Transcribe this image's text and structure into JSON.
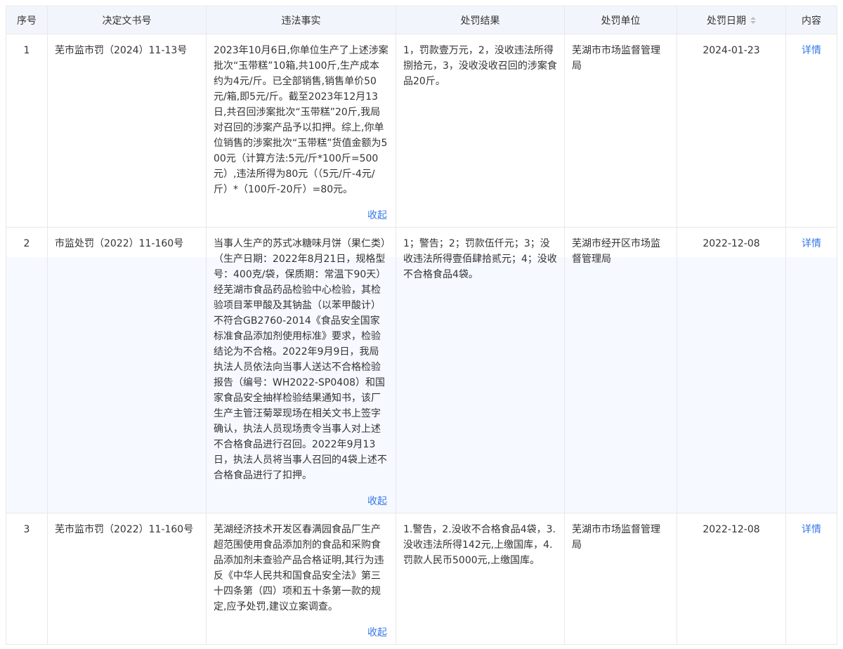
{
  "header": {
    "index": "序号",
    "doc_no": "决定文书号",
    "facts": "违法事实",
    "result": "处罚结果",
    "unit": "处罚单位",
    "date": "处罚日期",
    "content": "内容"
  },
  "rows": [
    {
      "index": "1",
      "doc_no": "芜市监市罚（2024）11-13号",
      "facts": "2023年10月6日,你单位生产了上述涉案批次“玉带糕”10箱,共100斤,生产成本约为4元/斤。已全部销售,销售单价50元/箱,即5元/斤。截至2023年12月13日,共召回涉案批次“玉带糕”20斤,我局对召回的涉案产品予以扣押。综上,你单位销售的涉案批次“玉带糕”货值金额为500元（计算方法:5元/斤*100斤=500元）,违法所得为80元（（5元/斤-4元/斤）*（100斤-20斤）=80元。",
      "result": "1，罚款壹万元，2，没收违法所得捌拾元，3，没收没收召回的涉案食品20斤。",
      "unit": "芜湖市市场监督管理局",
      "date": "2024-01-23",
      "detail": "详情",
      "collapse": "收起"
    },
    {
      "index": "2",
      "doc_no": "市监处罚（2022）11-160号",
      "facts": "当事人生产的苏式冰糖味月饼（果仁类）（生产日期：2022年8月21日，规格型号：400克/袋，保质期：常温下90天）经芜湖市食品药品检验中心检验，其检验项目苯甲酸及其钠盐（以苯甲酸计）不符合GB2760-2014《食品安全国家标准食品添加剂使用标准》要求，检验结论为不合格。2022年9月9日，我局执法人员依法向当事人送达不合格检验报告（编号：WH2022-SP0408）和国家食品安全抽样检验结果通知书，该厂生产主管汪菊翠现场在相关文书上签字确认，执法人员现场责令当事人对上述不合格食品进行召回。2022年9月13日，执法人员将当事人召回的4袋上述不合格食品进行了扣押。",
      "result": "1；警告；2；罚款伍仟元；3；没收违法所得壹佰肆拾贰元；4；没收不合格食品4袋。",
      "unit": "芜湖市经开区市场监督管理局",
      "date": "2022-12-08",
      "detail": "详情",
      "collapse": "收起"
    },
    {
      "index": "3",
      "doc_no": "芜市监市罚（2022）11-160号",
      "facts": "芜湖经济技术开发区春满园食品厂生产超范围使用食品添加剂的食品和采购食品添加剂未查验产品合格证明,其行为违反《中华人民共和国食品安全法》第三十四条第（四）项和五十条第一款的规定,应予处罚,建议立案调查。",
      "result": "1.警告，2.没收不合格食品4袋，3.没收违法所得142元,上缴国库，4.罚款人民币5000元,上缴国库。",
      "unit": "芜湖市市场监督管理局",
      "date": "2022-12-08",
      "detail": "详情",
      "collapse": "收起"
    }
  ],
  "colors": {
    "header_bg": "#f2f6fc",
    "border": "#e8e8e8",
    "link": "#3478e5",
    "row_shade": "#f6f9ff"
  },
  "icons": {
    "sort": "sort-caret-icon"
  }
}
